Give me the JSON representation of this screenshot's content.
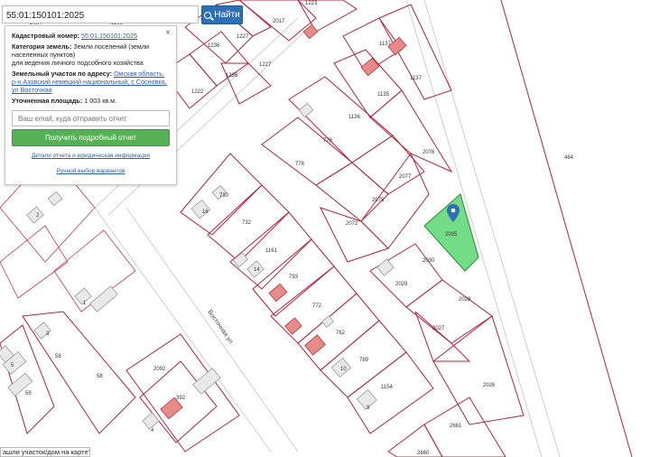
{
  "search": {
    "value": "55:01:150101:2025",
    "button_label": "Найти"
  },
  "panel": {
    "close": "×",
    "cadastral_label": "Кадастровый номер:",
    "cadastral_value": "55:01:150101:2025",
    "category_label": "Категория земель:",
    "category_value": "Земли поселений (земли населенных пунктов)",
    "category_value2": "для ведения личного подсобного хозяйства",
    "address_label": "Земельный участок по адресу:",
    "address_value": "Омская область, р-н Азовский немецкий национальный, с Сосновка, ул Восточная",
    "area_label": "Уточненная площадь:",
    "area_value": "1 003 кв.м.",
    "email_placeholder": "Ваш email, куда отправить отчет",
    "report_button": "Получить подробный отчет",
    "details_link": "Детали отчета и юридическая информация",
    "manual_link": "Ручной выбор вариантов"
  },
  "bottom_text": "ашли участок/дом на карте?",
  "map": {
    "street_name": "Восточная ул.",
    "labels": {
      "l2017": "2017",
      "l1227a": "1227",
      "l1236a": "1236",
      "l1227b": "1227",
      "l1236b": "1236",
      "l1222": "1222",
      "l1137a": "1137",
      "l1137b": "1137",
      "l1135": "1135",
      "l1136": "1136",
      "l776": "776",
      "l778": "778",
      "l2076": "2076",
      "l2077": "2077",
      "l2075": "2075",
      "l2072": "2072",
      "l2025": "2025",
      "l2030": "2030",
      "l2029": "2029",
      "l2028": "2028",
      "l2027": "2027",
      "l2026": "2026",
      "l464": "464",
      "l730": "730",
      "l16": "16",
      "l732": "732",
      "l1161": "1161",
      "l14": "14",
      "l793": "793",
      "l772": "772",
      "l762": "762",
      "l789": "789",
      "l10": "10",
      "l1154": "1154",
      "l9": "9",
      "l2661": "2661",
      "l2660": "2660",
      "l2": "2",
      "l1": "1",
      "l3": "3",
      "l58a": "58",
      "l58b": "58",
      "l5": "5",
      "l59": "59",
      "l2092": "2092",
      "l392": "392",
      "l4": "4",
      "l2064": "2064",
      "l1166": "1166",
      "l1223": "1223"
    },
    "colors": {
      "selected_fill": "#4fd468",
      "plot_line": "#b0243a",
      "marker": "#2f6fb3"
    }
  }
}
